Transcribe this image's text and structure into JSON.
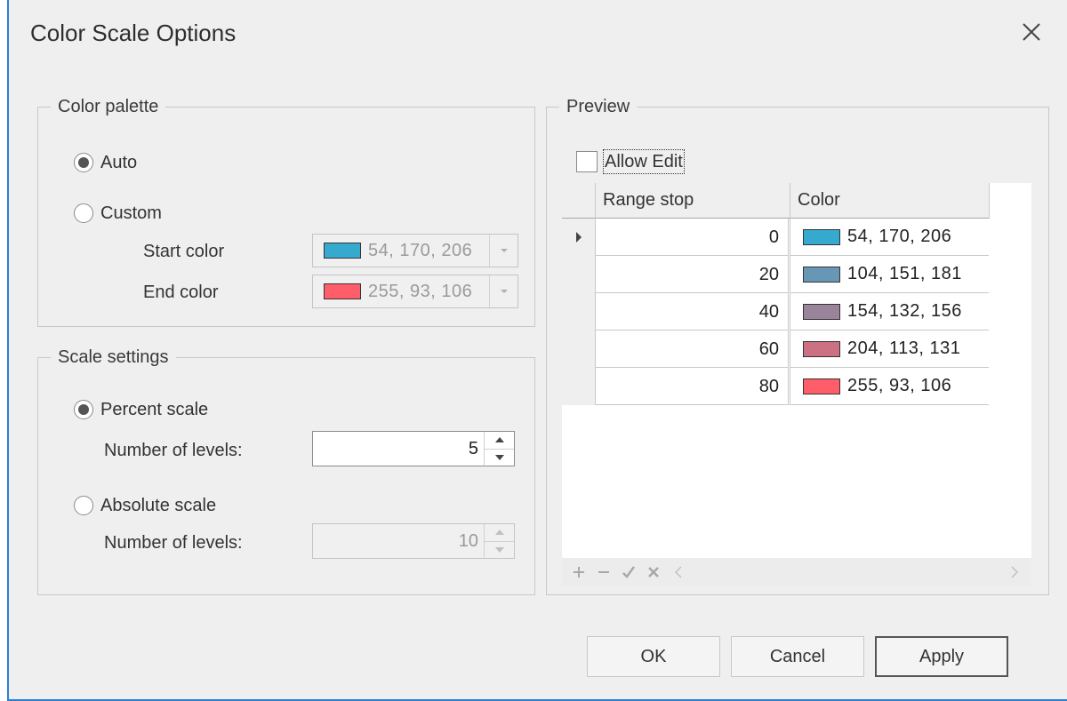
{
  "window": {
    "title": "Color Scale Options",
    "close_icon": "close-icon"
  },
  "color_palette": {
    "legend": "Color palette",
    "auto_label": "Auto",
    "custom_label": "Custom",
    "selected": "Auto",
    "start_color_label": "Start color",
    "start_color_value": "54, 170, 206",
    "start_color_hex": "#36aace",
    "end_color_label": "End color",
    "end_color_value": "255, 93, 106",
    "end_color_hex": "#ff5d6a"
  },
  "scale_settings": {
    "legend": "Scale settings",
    "percent_label": "Percent scale",
    "percent_levels_label": "Number of levels:",
    "percent_levels_value": "5",
    "absolute_label": "Absolute scale",
    "absolute_levels_label": "Number of levels:",
    "absolute_levels_value": "10",
    "selected": "Percent scale"
  },
  "preview": {
    "legend": "Preview",
    "allow_edit_label": "Allow Edit",
    "allow_edit_checked": false,
    "columns": [
      "Range stop",
      "Color"
    ],
    "rows": [
      {
        "stop": "0",
        "color": "54, 170, 206",
        "hex": "#36aace",
        "current": true
      },
      {
        "stop": "20",
        "color": "104, 151, 181",
        "hex": "#6897b5",
        "current": false
      },
      {
        "stop": "40",
        "color": "154, 132, 156",
        "hex": "#9a849c",
        "current": false
      },
      {
        "stop": "60",
        "color": "204, 113, 131",
        "hex": "#cc7183",
        "current": false
      },
      {
        "stop": "80",
        "color": "255, 93, 106",
        "hex": "#ff5d6a",
        "current": false
      }
    ],
    "navigator_icons": [
      "add-icon",
      "remove-icon",
      "accept-icon",
      "cancel-edit-icon",
      "scroll-left-icon",
      "scroll-right-icon"
    ]
  },
  "buttons": {
    "ok": "OK",
    "cancel": "Cancel",
    "apply": "Apply"
  }
}
